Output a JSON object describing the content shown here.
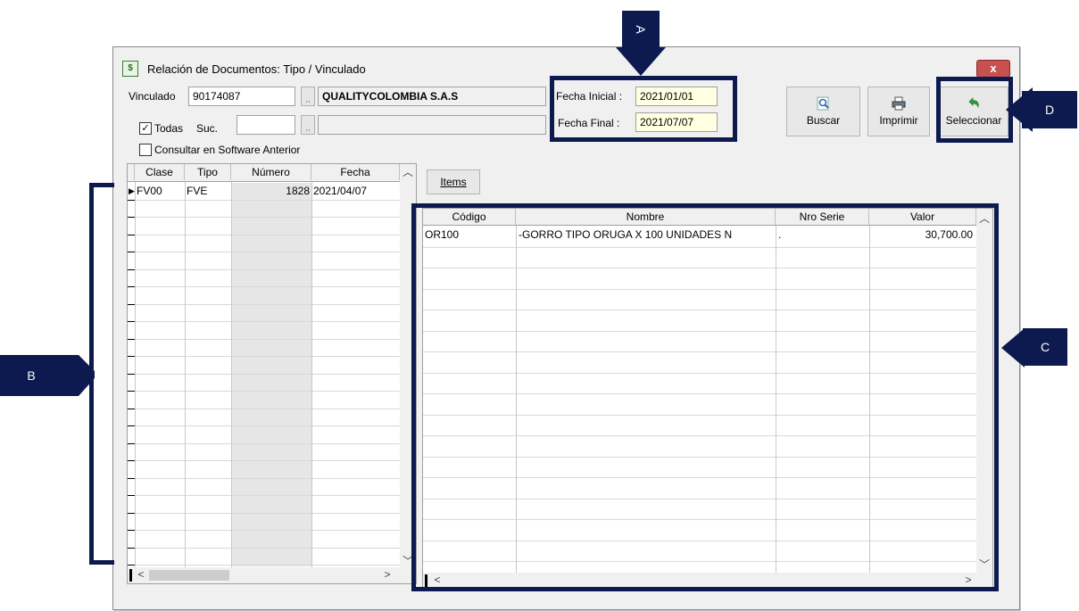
{
  "window": {
    "title": "Relación de Documentos: Tipo / Vinculado",
    "close_symbol": "x"
  },
  "filters": {
    "vinculado_label": "Vinculado",
    "vinculado_code": "90174087",
    "vinculado_name": "QUALITYCOLOMBIA S.A.S",
    "todas_label": "Todas",
    "todas_checked": true,
    "suc_label": "Suc.",
    "suc_value": "",
    "suc_name": "",
    "consultar_label": "Consultar en Software Anterior",
    "consultar_checked": false,
    "ellipsis": ",,"
  },
  "dates": {
    "inicial_label": "Fecha Inicial :",
    "inicial_value": "2021/01/01",
    "final_label": "Fecha Final :",
    "final_value": "2021/07/07"
  },
  "toolbar": {
    "buscar": "Buscar",
    "imprimir": "Imprimir",
    "seleccionar": "Seleccionar"
  },
  "documents_grid": {
    "columns": [
      "Clase",
      "Tipo",
      "Número",
      "Fecha"
    ],
    "rows": [
      {
        "clase": "FV00",
        "tipo": "FVE",
        "numero": "1828",
        "fecha": "2021/04/07"
      }
    ]
  },
  "items_button": "Items",
  "items_grid": {
    "columns": [
      "Código",
      "Nombre",
      "Nro Serie",
      "Valor"
    ],
    "rows": [
      {
        "codigo": "OR100",
        "nombre": "-GORRO TIPO ORUGA X 100 UNIDADES N",
        "serie": ".",
        "valor": "30,700.00"
      }
    ]
  },
  "callouts": {
    "a": "A",
    "b": "B",
    "c": "C",
    "d": "D"
  },
  "colors": {
    "callout_navy": "#0d1a4f",
    "date_field_bg": "#ffffe1",
    "close_button": "#c75050"
  }
}
